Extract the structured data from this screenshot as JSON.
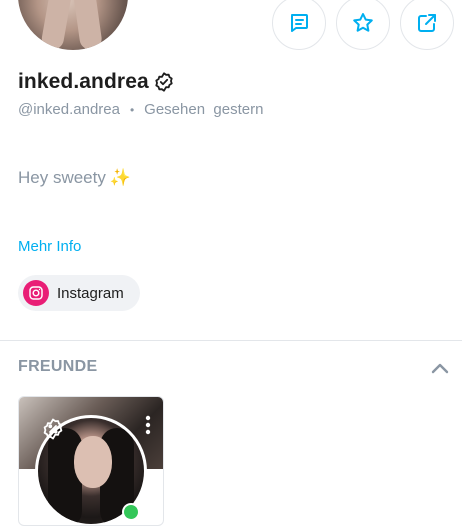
{
  "profile": {
    "display_name": "inked.andrea",
    "handle": "@inked.andrea",
    "separator": "•",
    "last_seen": "Gesehen  gestern",
    "bio": "Hey sweety",
    "bio_emoji": "✨",
    "more_info_label": "Mehr Info",
    "social_link_label": "Instagram"
  },
  "actions": {
    "icons": [
      "message-icon",
      "star-icon",
      "share-icon"
    ]
  },
  "friends": {
    "section_title": "FREUNDE",
    "online_color": "#34c759"
  },
  "colors": {
    "accent": "#00aff0",
    "muted_text": "#8a96a3",
    "instagram": "#e91e76"
  }
}
